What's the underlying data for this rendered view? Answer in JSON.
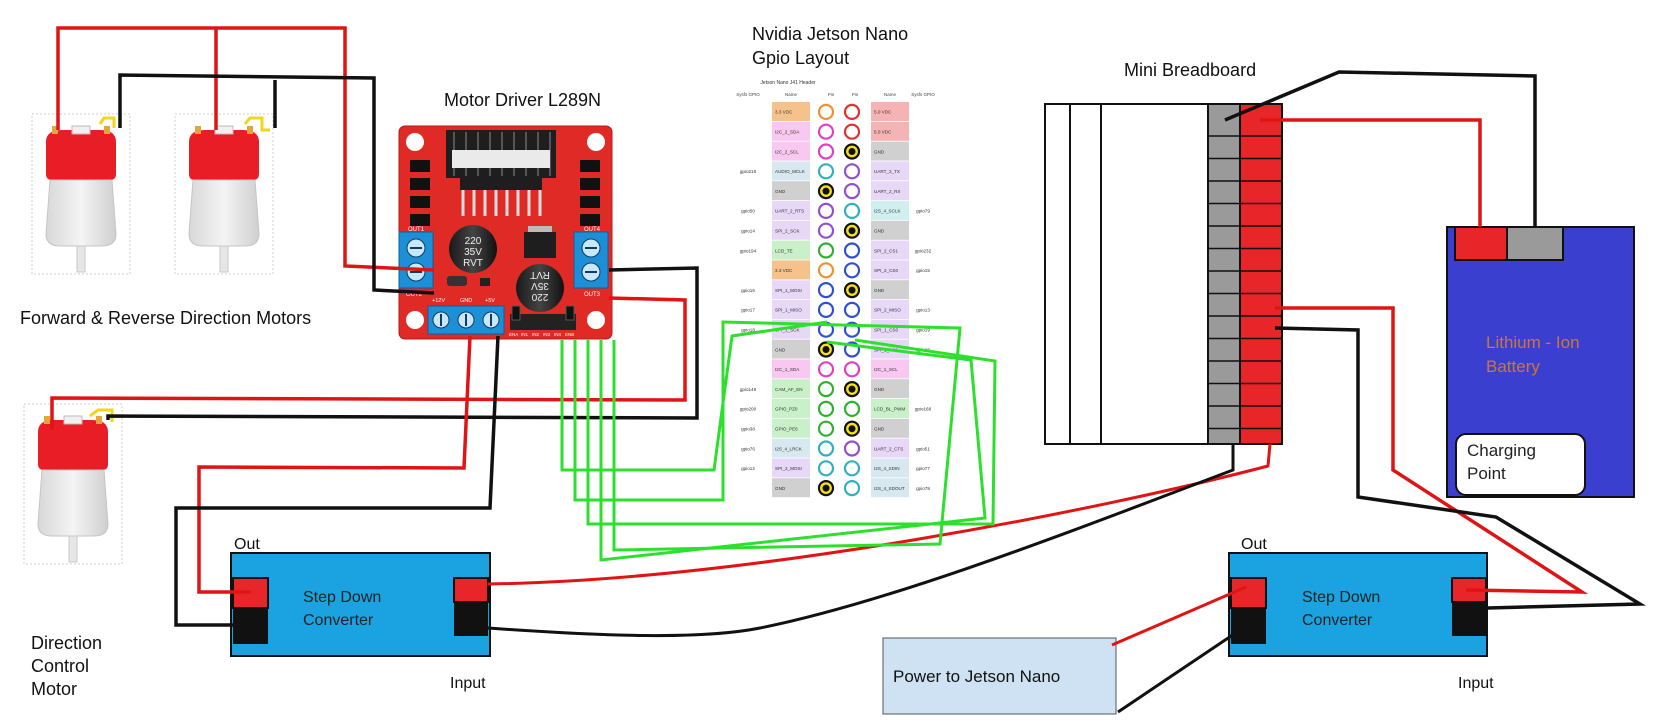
{
  "labels": {
    "motor_driver_title": "Motor Driver L289N",
    "jetson_title_line1": "Nvidia Jetson Nano",
    "jetson_title_line2": "Gpio Layout",
    "breadboard_title": "Mini Breadboard",
    "forward_reverse_motors": "Forward & Reverse Direction Motors",
    "direction_control_line1": "Direction",
    "direction_control_line2": "Control",
    "direction_control_line3": "Motor",
    "converter_left_out": "Out",
    "converter_left_input": "Input",
    "converter_left_line1": "Step Down",
    "converter_left_line2": "Converter",
    "converter_right_out": "Out",
    "converter_right_input": "Input",
    "converter_right_line1": "Step Down",
    "converter_right_line2": "Converter",
    "power_to_jetson": "Power to Jetson Nano",
    "battery_line1": "Lithium - Ion",
    "battery_line2": "Battery",
    "charging_line1": "Charging",
    "charging_line2": "Point"
  },
  "driver_board": {
    "terminal_labels": [
      "OUT1",
      "OUT2",
      "OUT4",
      "OUT3",
      "+12V",
      "GND",
      "+5V",
      "ENA",
      "IN1",
      "IN2",
      "IN3",
      "IN4",
      "ENB"
    ],
    "capacitor_text": [
      "220",
      "35V",
      "RVT"
    ]
  },
  "gpio_header": {
    "title": "Jetson Nano J41 Header",
    "columns": [
      "Sysfs GPIO",
      "Name",
      "Pin",
      "Pin",
      "Name",
      "Sysfs GPIO"
    ],
    "rows": [
      {
        "lg": "",
        "ln": "3.3 VDC",
        "rn": "5.0 VDC",
        "rg": ""
      },
      {
        "lg": "",
        "ln": "I2C_2_SDA",
        "rn": "5.0 VDC",
        "rg": ""
      },
      {
        "lg": "",
        "ln": "I2C_2_SCL",
        "rn": "GND",
        "rg": ""
      },
      {
        "lg": "gpio216",
        "ln": "AUDIO_MCLK",
        "rn": "UART_2_TX",
        "rg": ""
      },
      {
        "lg": "",
        "ln": "GND",
        "rn": "UART_2_RX",
        "rg": ""
      },
      {
        "lg": "gpio50",
        "ln": "UART_2_RTS",
        "rn": "I2S_4_SCLK",
        "rg": "gpio79"
      },
      {
        "lg": "gpio14",
        "ln": "SPI_2_SCK",
        "rn": "GND",
        "rg": ""
      },
      {
        "lg": "gpio194",
        "ln": "LCD_TE",
        "rn": "SPI_2_CS1",
        "rg": "gpio232"
      },
      {
        "lg": "",
        "ln": "3.3 VDC",
        "rn": "SPI_2_CS0",
        "rg": "gpio15"
      },
      {
        "lg": "gpio16",
        "ln": "SPI_1_MOSI",
        "rn": "GND",
        "rg": ""
      },
      {
        "lg": "gpio17",
        "ln": "SPI_1_MISO",
        "rn": "SPI_2_MISO",
        "rg": "gpio13"
      },
      {
        "lg": "gpio18",
        "ln": "SPI_1_SCK",
        "rn": "SPI_1_CS0",
        "rg": "gpio19"
      },
      {
        "lg": "",
        "ln": "GND",
        "rn": "SPI_1_CS1",
        "rg": "gpio20"
      },
      {
        "lg": "",
        "ln": "I2C_1_SDA",
        "rn": "I2C_1_SCL",
        "rg": ""
      },
      {
        "lg": "gpio149",
        "ln": "CAM_AF_EN",
        "rn": "GND",
        "rg": ""
      },
      {
        "lg": "gpio200",
        "ln": "GPIO_PZ0",
        "rn": "LCD_BL_PWM",
        "rg": "gpio168"
      },
      {
        "lg": "gpio38",
        "ln": "GPIO_PE6",
        "rn": "GND",
        "rg": ""
      },
      {
        "lg": "gpio76",
        "ln": "I2S_4_LRCK",
        "rn": "UART_2_CTS",
        "rg": "gpio51"
      },
      {
        "lg": "gpio12",
        "ln": "SPI_2_MOSI",
        "rn": "I2S_4_SDIN",
        "rg": "gpio77"
      },
      {
        "lg": "",
        "ln": "GND",
        "rn": "I2S_4_SDOUT",
        "rg": "gpio78"
      }
    ]
  },
  "colors": {
    "wire_red": "#e01414",
    "wire_black": "#111111",
    "wire_green": "#2ee02e",
    "driver_red": "#e02a25",
    "terminal_blue": "#1c8fd6",
    "converter_blue": "#1aa3e0",
    "battery_blue": "#3b3fcf",
    "battery_text": "#c9773a",
    "power_box": "#cfe2f3",
    "breadboard_red": "#e8262a",
    "breadboard_gray": "#9a9a9a"
  },
  "icons": {
    "motor": "dc-motor-icon",
    "capacitor": "capacitor-icon",
    "heatsink": "heatsink-icon"
  }
}
